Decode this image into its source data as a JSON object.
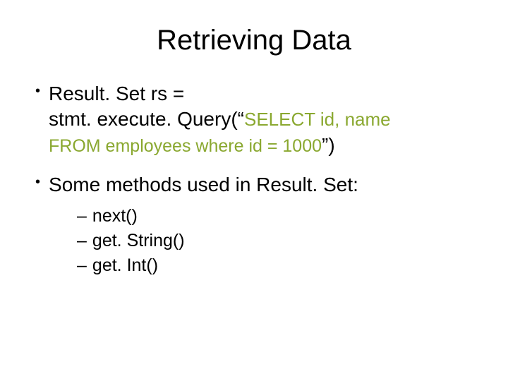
{
  "title": "Retrieving Data",
  "bullets": [
    {
      "line1": "Result. Set rs =",
      "line2_code": "stmt. execute. Query(“",
      "line2_sql": "SELECT id, name",
      "line3_sql": "FROM employees where id = 1000",
      "line3_close": "”)"
    },
    {
      "text": "Some methods used in Result. Set:",
      "subs": [
        "next()",
        "get. String()",
        "get. Int()"
      ]
    }
  ]
}
